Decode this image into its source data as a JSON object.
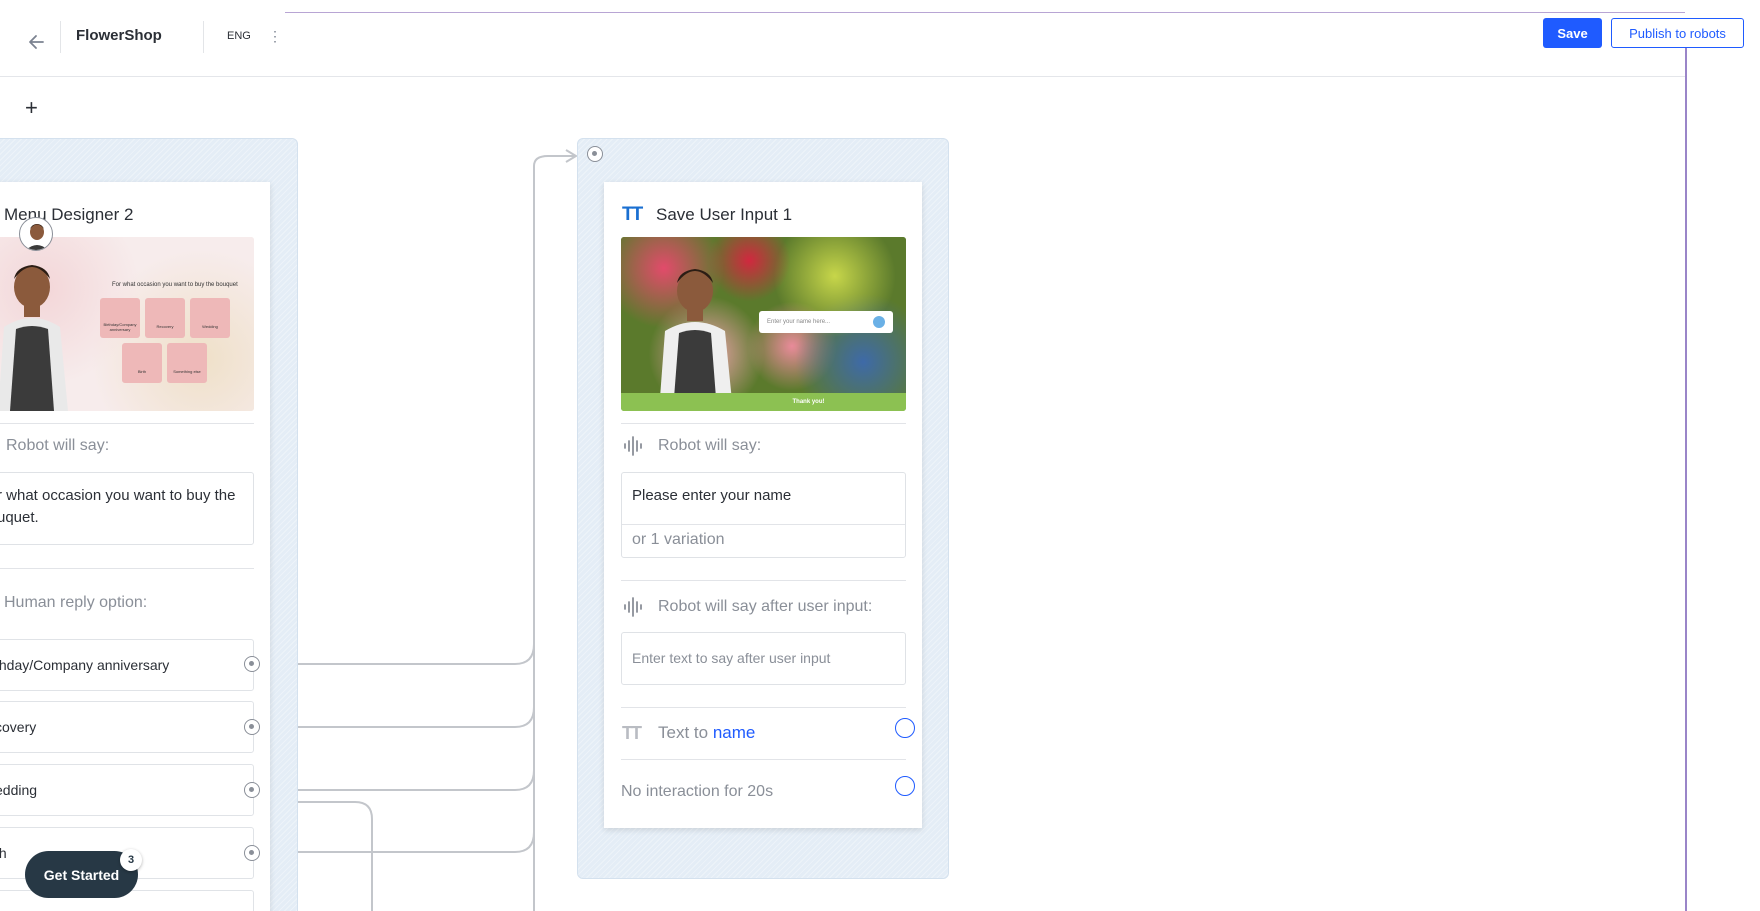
{
  "header": {
    "title": "FlowerShop",
    "language": "ENG",
    "save_label": "Save",
    "publish_label": "Publish to robots"
  },
  "canvas": {
    "add_label": "+"
  },
  "menu_card": {
    "title": "Menu Designer 2",
    "preview": {
      "question": "For what occasion you want to buy the bouquet",
      "tiles": [
        "Birthday/Company anniversary",
        "Recovery",
        "Wedding",
        "Birth",
        "Something else"
      ]
    },
    "robot_label": "Robot will say:",
    "robot_text": "r what occasion you want to buy the\nuquet.",
    "human_label": "Human reply option:",
    "replies": [
      "thday/Company anniversary",
      "covery",
      "edding",
      "th"
    ]
  },
  "input_card": {
    "title": "Save User Input 1",
    "preview": {
      "placeholder": "Enter your name here...",
      "footer": "Thank you!"
    },
    "robot_label": "Robot will say:",
    "robot_text": "Please enter your name",
    "variation_text": "or 1 variation",
    "after_label": "Robot will say after user input:",
    "after_placeholder": "Enter text to say after user input",
    "text_to_prefix": "Text to",
    "text_to_var": "name",
    "timeout_label": "No interaction for 20s"
  },
  "onboarding": {
    "button_label": "Get Started",
    "badge_count": "3"
  },
  "colors": {
    "primary": "#1f5bff",
    "dark": "#273845",
    "group_bg": "#e4edf6"
  }
}
